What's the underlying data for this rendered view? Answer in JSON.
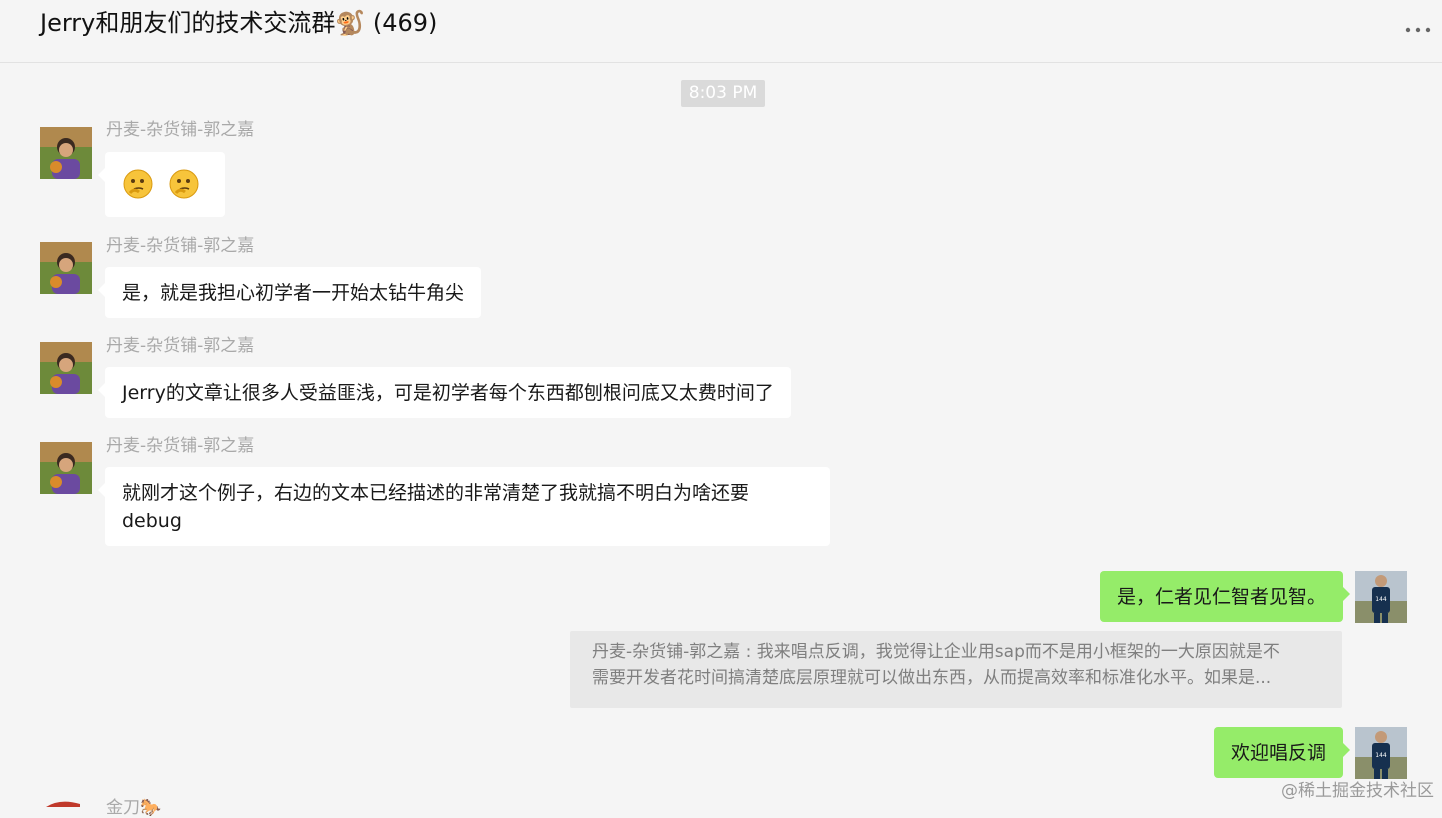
{
  "header": {
    "title": "Jerry和朋友们的技术交流群🐒 (469)",
    "more_icon": "more-dots-icon"
  },
  "timestamp": "8:03 PM",
  "messages": [
    {
      "sender": "丹麦-杂货铺-郭之嘉",
      "type": "emoji",
      "emoji_icon": "thinking-face-icon",
      "emoji_count": 2
    },
    {
      "sender": "丹麦-杂货铺-郭之嘉",
      "text": "是，就是我担心初学者一开始太钻牛角尖"
    },
    {
      "sender": "丹麦-杂货铺-郭之嘉",
      "text": "Jerry的文章让很多人受益匪浅，可是初学者每个东西都刨根问底又太费时间了"
    },
    {
      "sender": "丹麦-杂货铺-郭之嘉",
      "text_line1": "就刚才这个例子，右边的文本已经描述的非常清楚了我就搞不明白为啥还要",
      "text_line2": "debug"
    },
    {
      "sender": "self",
      "text": "是，仁者见仁智者见智。"
    },
    {
      "sender": "self",
      "type": "quote",
      "quote_line1": "丹麦-杂货铺-郭之嘉 : 我来唱点反调，我觉得让企业用sap而不是用小框架的一大原因就是不",
      "quote_line2": "需要开发者花时间搞清楚底层原理就可以做出东西，从而提高效率和标准化水平。如果是..."
    },
    {
      "sender": "self",
      "text": "欢迎唱反调"
    }
  ],
  "next_sender": "金刀🐎",
  "watermark": "@稀土掘金技术社区",
  "colors": {
    "background": "#f5f5f5",
    "self_bubble": "#95ec69",
    "other_bubble": "#ffffff",
    "sender_name": "#a9a9a9"
  }
}
